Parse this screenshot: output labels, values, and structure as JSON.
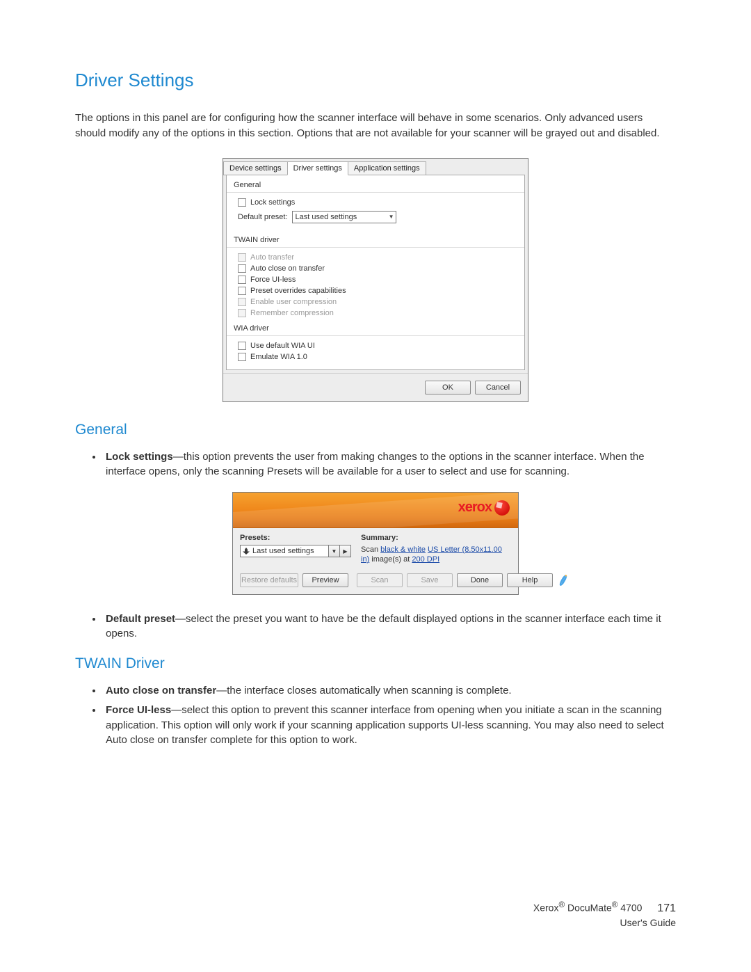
{
  "page_title": "Driver Settings",
  "intro": "The options in this panel are for configuring how the scanner interface will behave in some scenarios. Only advanced users should modify any of the options in this section. Options that are not available for your scanner will be grayed out and disabled.",
  "dialog1": {
    "tabs": {
      "device": "Device settings",
      "driver": "Driver settings",
      "app": "Application settings"
    },
    "general": {
      "label": "General",
      "lock": "Lock settings",
      "default_preset_label": "Default preset:",
      "default_preset_value": "Last used settings"
    },
    "twain": {
      "label": "TWAIN driver",
      "auto_transfer": "Auto transfer",
      "auto_close": "Auto close on transfer",
      "force_uiless": "Force UI-less",
      "preset_overrides": "Preset overrides capabilities",
      "enable_compression": "Enable user compression",
      "remember_compression": "Remember compression"
    },
    "wia": {
      "label": "WIA driver",
      "use_default": "Use default WIA UI",
      "emulate": "Emulate WIA 1.0"
    },
    "buttons": {
      "ok": "OK",
      "cancel": "Cancel"
    }
  },
  "sections": {
    "general": "General",
    "twain": "TWAIN Driver"
  },
  "bullets": {
    "lock": {
      "term": "Lock settings",
      "desc": "—this option prevents the user from making changes to the options in the scanner interface. When the interface opens, only the scanning Presets will be available for a user to select and use for scanning."
    },
    "default_preset": {
      "term": "Default preset",
      "desc": "—select the preset you want to have be the default displayed options in the scanner interface each time it opens."
    },
    "auto_close": {
      "term": "Auto close on transfer",
      "desc": "—the interface closes automatically when scanning is complete."
    },
    "force_uiless": {
      "term": "Force UI-less",
      "desc": "—select this option to prevent this scanner interface from opening when you initiate a scan in the scanning application. This option will only work if your scanning application supports UI-less scanning. You may also need to select Auto close on transfer complete for this option to work."
    }
  },
  "dialog2": {
    "logo": "xerox",
    "presets_label": "Presets:",
    "preset_value": "Last used settings",
    "summary_label": "Summary:",
    "summary_prefix": "Scan ",
    "summary_link1": "black & white",
    "summary_mid1": " ",
    "summary_link2": "US Letter (8.50x11.00 in)",
    "summary_mid2": " image(s) at ",
    "summary_link3": "200 DPI",
    "buttons": {
      "restore": "Restore defaults",
      "preview": "Preview",
      "scan": "Scan",
      "save": "Save",
      "done": "Done",
      "help": "Help"
    }
  },
  "footer": {
    "line1a": "Xerox",
    "line1b": " DocuMate",
    "line1c": " 4700",
    "line2": "User's Guide",
    "page": "171"
  }
}
